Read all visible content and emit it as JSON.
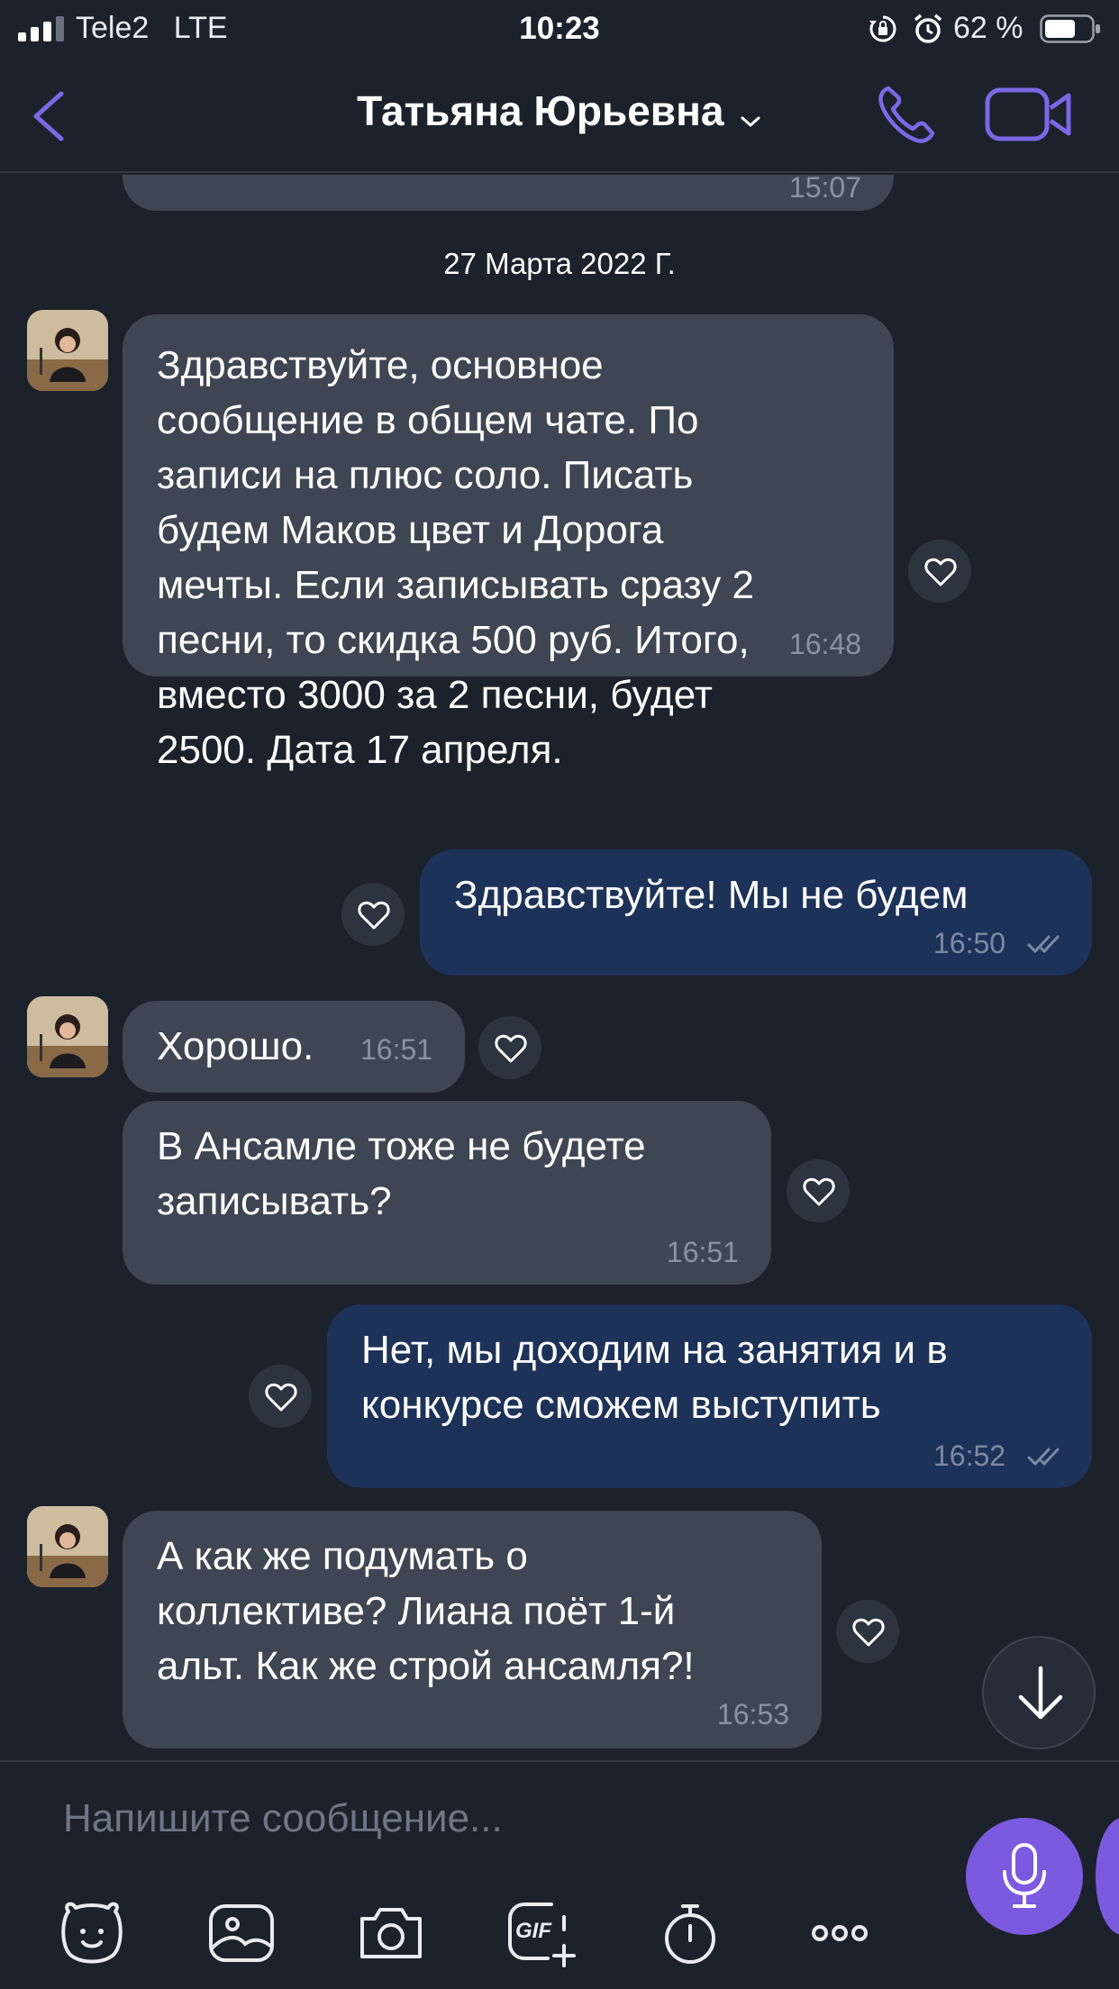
{
  "status_bar": {
    "carrier": "Tele2",
    "network": "LTE",
    "time": "10:23",
    "battery_percent": "62 %"
  },
  "header": {
    "contact_name": "Татьяна Юрьевна",
    "icons": [
      "back-chevron-icon",
      "chevron-down-icon",
      "phone-icon",
      "video-camera-icon"
    ]
  },
  "chat": {
    "prev_time": "15:07",
    "date_separator": "27 Марта 2022 Г.",
    "messages": [
      {
        "direction": "incoming",
        "text": "Здравствуйте, основное\nсообщение в общем чате. По\nзаписи на плюс соло. Писать\nбудем Маков цвет и Дорога\nмечты. Если записывать сразу 2\nпесни, то скидка 500 руб. Итого,\nвместо 3000 за 2 песни, будет\n2500. Дата 17 апреля.",
        "time": "16:48"
      },
      {
        "direction": "outgoing",
        "text": "Здравствуйте! Мы не будем",
        "time": "16:50"
      },
      {
        "direction": "incoming",
        "text": "Хорошо.",
        "time": "16:51"
      },
      {
        "direction": "incoming",
        "text": "В Ансамле тоже не будете\nзаписывать?",
        "time": "16:51"
      },
      {
        "direction": "outgoing",
        "text": "Нет, мы доходим на занятия и в\nконкурсе сможем выступить",
        "time": "16:52"
      },
      {
        "direction": "incoming",
        "text": "А как же подумать о\nколлективе? Лиана поёт 1-й\nальт. Как же строй ансамля?!",
        "time": "16:53"
      }
    ]
  },
  "composer": {
    "placeholder": "Напишите сообщение...",
    "gif_label": "GIF",
    "tools": [
      "sticker-icon",
      "gallery-icon",
      "camera-icon",
      "gif-icon",
      "timer-icon",
      "more-icon"
    ]
  },
  "colors": {
    "background": "#1c222b",
    "incoming_bubble": "#3f4653",
    "outgoing_bubble": "#1d3258",
    "accent": "#7c5ae0"
  }
}
